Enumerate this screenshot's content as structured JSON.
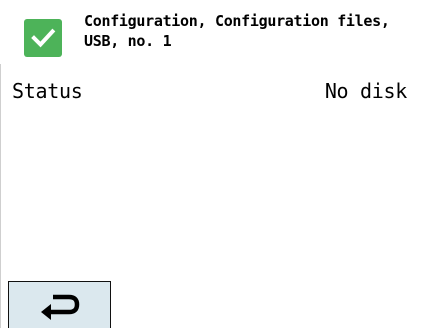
{
  "header": {
    "check_icon": "checkmark-icon",
    "check_color": "#4db359",
    "title_line1": "Configuration, Configuration files,",
    "title_line2": "USB, no. 1"
  },
  "status": {
    "label": "Status",
    "value": "No disk"
  },
  "footer": {
    "back_icon": "return-arrow-icon",
    "back_bg": "#dbe8ee"
  }
}
